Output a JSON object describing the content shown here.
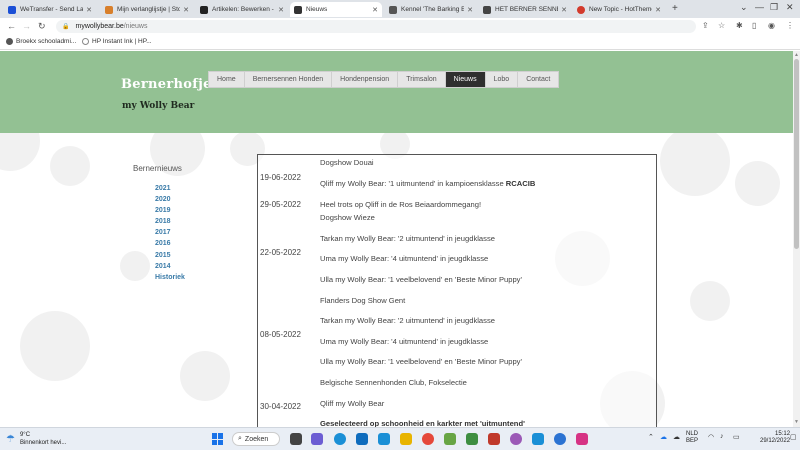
{
  "browser": {
    "tabs": [
      {
        "title": "WeTransfer - Send Larg...",
        "fav": "#1b4fd6",
        "active": false
      },
      {
        "title": "Mijn verlanglijstje | Sto...",
        "fav": "#d87f2b",
        "active": false
      },
      {
        "title": "Artikelen: Bewerken - E...",
        "fav": "#222222",
        "active": false
      },
      {
        "title": "Nieuws",
        "fav": "#333333",
        "active": true
      },
      {
        "title": "Kennel 'The Barking Bi...",
        "fav": "#555555",
        "active": false
      },
      {
        "title": "HET BERNER SENNEN ...",
        "fav": "#444444",
        "active": false
      },
      {
        "title": "New Topic - HotTheme...",
        "fav": "#d33a2c",
        "active": false
      }
    ],
    "new_tab": "+",
    "url_host": "mywollybear.be",
    "url_path": "/nieuws",
    "bookmarks": [
      {
        "label": "Broekx schooladmi...",
        "color": "#555555"
      },
      {
        "label": "HP Instant Ink | HP...",
        "color": "#888888"
      }
    ]
  },
  "site": {
    "brand_title": "Bernerhofje",
    "brand_subtitle": "my Wolly Bear",
    "menu": [
      {
        "label": "Home",
        "active": false
      },
      {
        "label": "Bernersennen Honden",
        "active": false
      },
      {
        "label": "Hondenpension",
        "active": false
      },
      {
        "label": "Trimsalon",
        "active": false
      },
      {
        "label": "Nieuws",
        "active": true
      },
      {
        "label": "Lobo",
        "active": false
      },
      {
        "label": "Contact",
        "active": false
      }
    ],
    "sidebar_title": "Bernernieuws",
    "years": [
      "2021",
      "2020",
      "2019",
      "2018",
      "2017",
      "2016",
      "2015",
      "2014",
      "Historiek"
    ]
  },
  "news": {
    "dates": [
      "19-06-2022",
      "29-05-2022",
      "22-05-2022",
      "08-05-2022",
      "30-04-2022"
    ],
    "items": [
      "Dogshow Douai",
      "Qliff my Wolly Bear: '1 uitmuntend' in kampioensklasse ",
      "RCACIB",
      "Heel trots op Qliff in de Ros Beiaardommegang!",
      "Dogshow Wieze",
      "Tarkan my Wolly Bear: '2 uitmuntend' in jeugdklasse",
      "Uma my Wolly Bear: '4 uitmuntend' in jeugdklasse",
      "Ulla my Wolly Bear: '1 veelbelovend' en 'Beste Minor Puppy'",
      "Flanders Dog Show Gent",
      "Tarkan my Wolly Bear: '2 uitmuntend' in jeugdklasse",
      "Uma my Wolly Bear: '4 uitmuntend' in jeugdklasse",
      "Ulla my Wolly Bear: '1 veelbelovend' en 'Beste Minor Puppy'",
      "Belgische Sennenhonden Club, Fokselectie",
      "Qliff my Wolly Bear",
      "Geselecteerd op schoonheid en karkter met 'uitmuntend'"
    ]
  },
  "taskbar": {
    "weather_temp": "9°C",
    "weather_text": "Binnenkort hevi...",
    "search_label": "Zoeken",
    "lang1": "NLD",
    "lang2": "BEP",
    "time": "15:12",
    "date": "29/12/2022"
  }
}
